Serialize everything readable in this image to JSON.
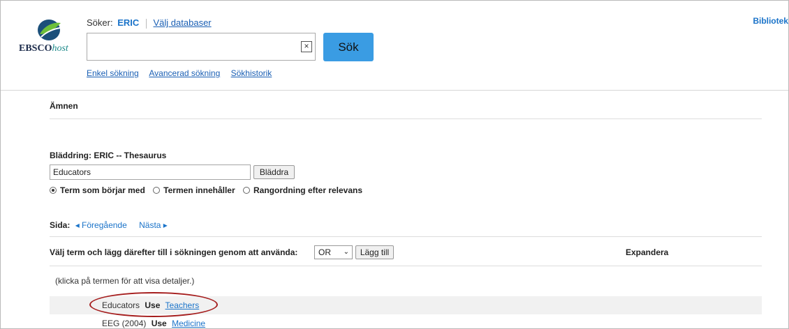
{
  "header": {
    "logo": {
      "brand_bold": "EBSCO",
      "brand_italic": "host"
    },
    "searching_label": "Söker:",
    "database_name": "ERIC",
    "choose_databases": "Välj databaser",
    "search_input": {
      "value": "",
      "placeholder": ""
    },
    "clear_symbol": "×",
    "search_button": "Sök",
    "links": [
      "Enkel sökning",
      "Avancerad sökning",
      "Sökhistorik"
    ],
    "top_right_link": "Biblioteken"
  },
  "content": {
    "section_title": "Ämnen",
    "browse_label": "Bläddring: ERIC -- Thesaurus",
    "browse_input_value": "Educators",
    "browse_button": "Bläddra",
    "options": [
      {
        "label": "Term som börjar med",
        "selected": true
      },
      {
        "label": "Termen innehåller",
        "selected": false
      },
      {
        "label": "Rangordning efter relevans",
        "selected": false
      }
    ],
    "pager": {
      "label": "Sida:",
      "prev": "◂ Föregående",
      "next": "Nästa ▸"
    },
    "select_row": {
      "text": "Välj term och lägg därefter till i sökningen genom att använda:",
      "operator": "OR",
      "add_button": "Lägg till",
      "expand_header": "Expandera"
    },
    "hint": "(klicka på termen för att visa detaljer.)",
    "terms": [
      {
        "term": "Educators",
        "use_label": "Use",
        "use_term": "Teachers",
        "highlighted": true
      },
      {
        "term": "EEG (2004)",
        "use_label": "Use",
        "use_term": "Medicine",
        "highlighted": false
      }
    ]
  },
  "colors": {
    "link": "#1a73c9",
    "search_button": "#3a9ce3",
    "highlight_circle": "#a51d1d",
    "row_shade": "#f1f1f1"
  }
}
